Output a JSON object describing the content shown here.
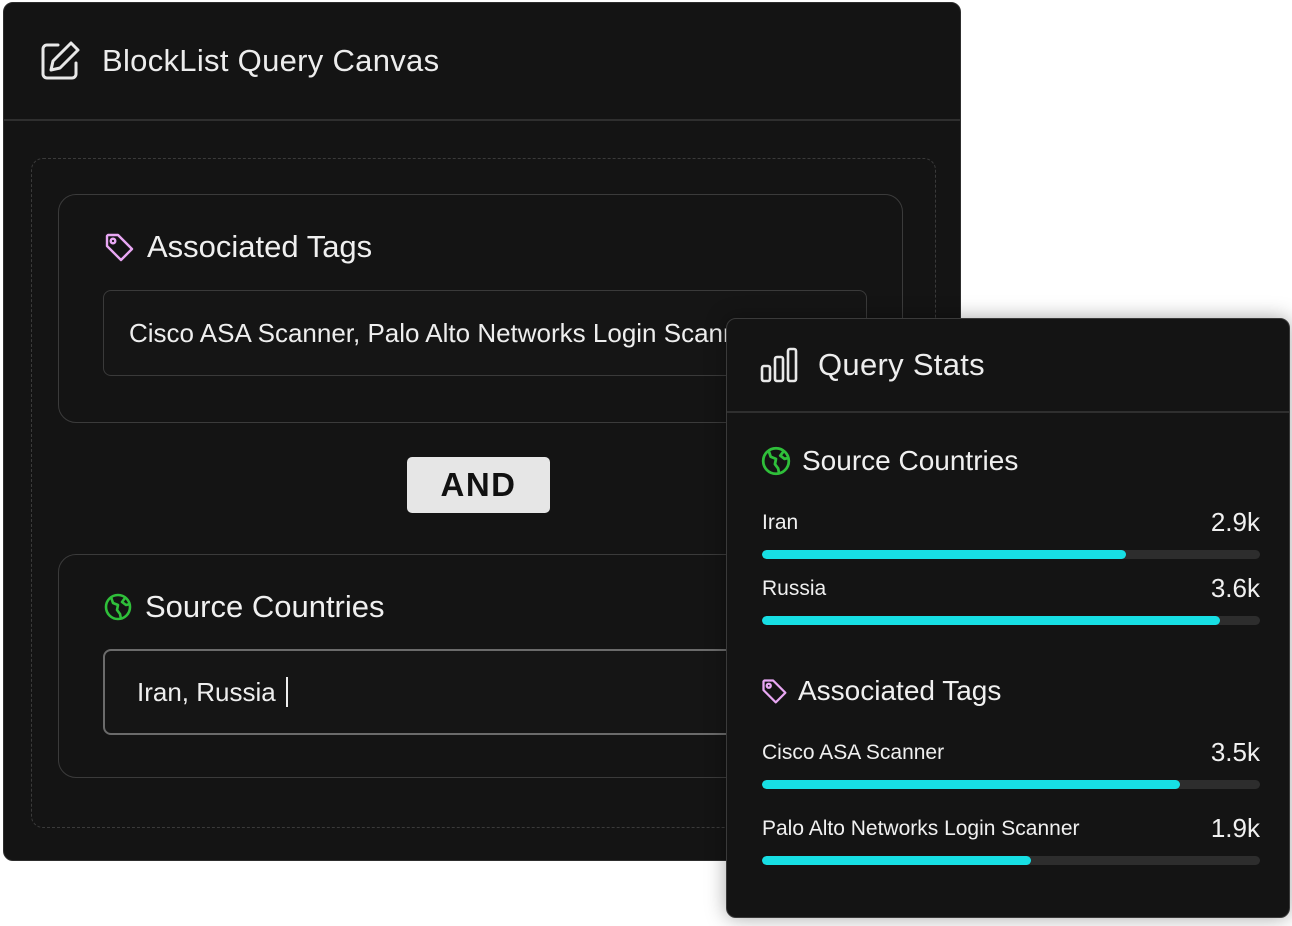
{
  "canvas": {
    "title": "BlockList Query Canvas",
    "icon": "edit-icon",
    "operator": "AND",
    "tags_group": {
      "title": "Associated Tags",
      "icon": "tag-icon",
      "value": "Cisco ASA Scanner, Palo Alto Networks Login Scanner"
    },
    "countries_group": {
      "title": "Source Countries",
      "icon": "globe-icon",
      "value": "Iran, Russia"
    }
  },
  "stats": {
    "title": "Query Stats",
    "icon": "bar-chart-icon",
    "countries": {
      "title": "Source Countries",
      "items": [
        {
          "label": "Iran",
          "value": "2.9k",
          "fill": 0.73
        },
        {
          "label": "Russia",
          "value": "3.6k",
          "fill": 0.92
        }
      ]
    },
    "tags": {
      "title": "Associated Tags",
      "items": [
        {
          "label": "Cisco ASA Scanner",
          "value": "3.5k",
          "fill": 0.84
        },
        {
          "label": "Palo Alto Networks Login Scanner",
          "value": "1.9k",
          "fill": 0.54
        }
      ]
    }
  },
  "colors": {
    "accent": "#17dfe4",
    "tag_icon": "#e8a7f3",
    "globe_icon": "#2fbf3a",
    "background": "#141414",
    "operator_badge": "#e6e6e6"
  }
}
